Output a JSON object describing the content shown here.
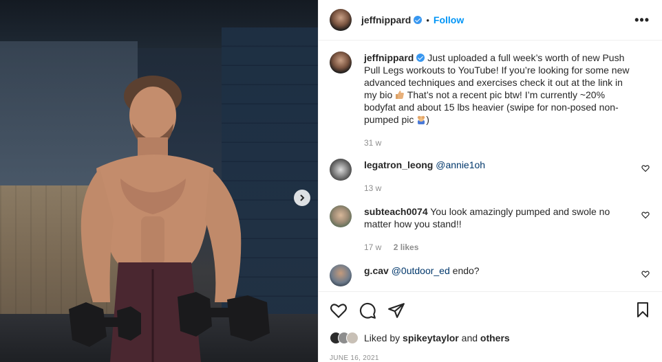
{
  "post": {
    "username": "jeffnippard",
    "dot": "•",
    "follow_label": "Follow",
    "more_label": "•••",
    "caption_user": "jeffnippard",
    "caption_part1": "Just uploaded a full week’s worth of new Push Pull Legs workouts to YouTube! If you’re looking for some new advanced techniques and exercises check it out at the link in my bio",
    "caption_part2": "That’s not a recent pic btw! I’m currently ~20% bodyfat and about 15 lbs heavier (swipe for non-posed non-pumped pic",
    "caption_part3": ")",
    "caption_age": "31 w"
  },
  "comments": [
    {
      "user": "legatron_leong",
      "mention": "@annie1oh",
      "text": "",
      "age": "13 w",
      "likes": ""
    },
    {
      "user": "subteach0074",
      "mention": "",
      "text": "You look amazingly pumped and swole no matter how you stand!!",
      "age": "17 w",
      "likes": "2 likes"
    },
    {
      "user": "g.cav",
      "mention": "@0utdoor_ed",
      "text": "endo?",
      "age": "",
      "likes": ""
    }
  ],
  "liked_by": {
    "prefix": "Liked by",
    "user": "spikeytaylor",
    "middle": "and",
    "others": "others"
  },
  "date": "JUNE 16, 2021",
  "colors": {
    "accent": "#0095f6",
    "verified": "#3897f0",
    "text": "#262626",
    "muted": "#8e8e8e"
  },
  "icons": [
    "verified-badge-icon",
    "more-options-icon",
    "heart-icon",
    "comment-icon",
    "share-icon",
    "bookmark-icon",
    "next-arrow-icon"
  ]
}
